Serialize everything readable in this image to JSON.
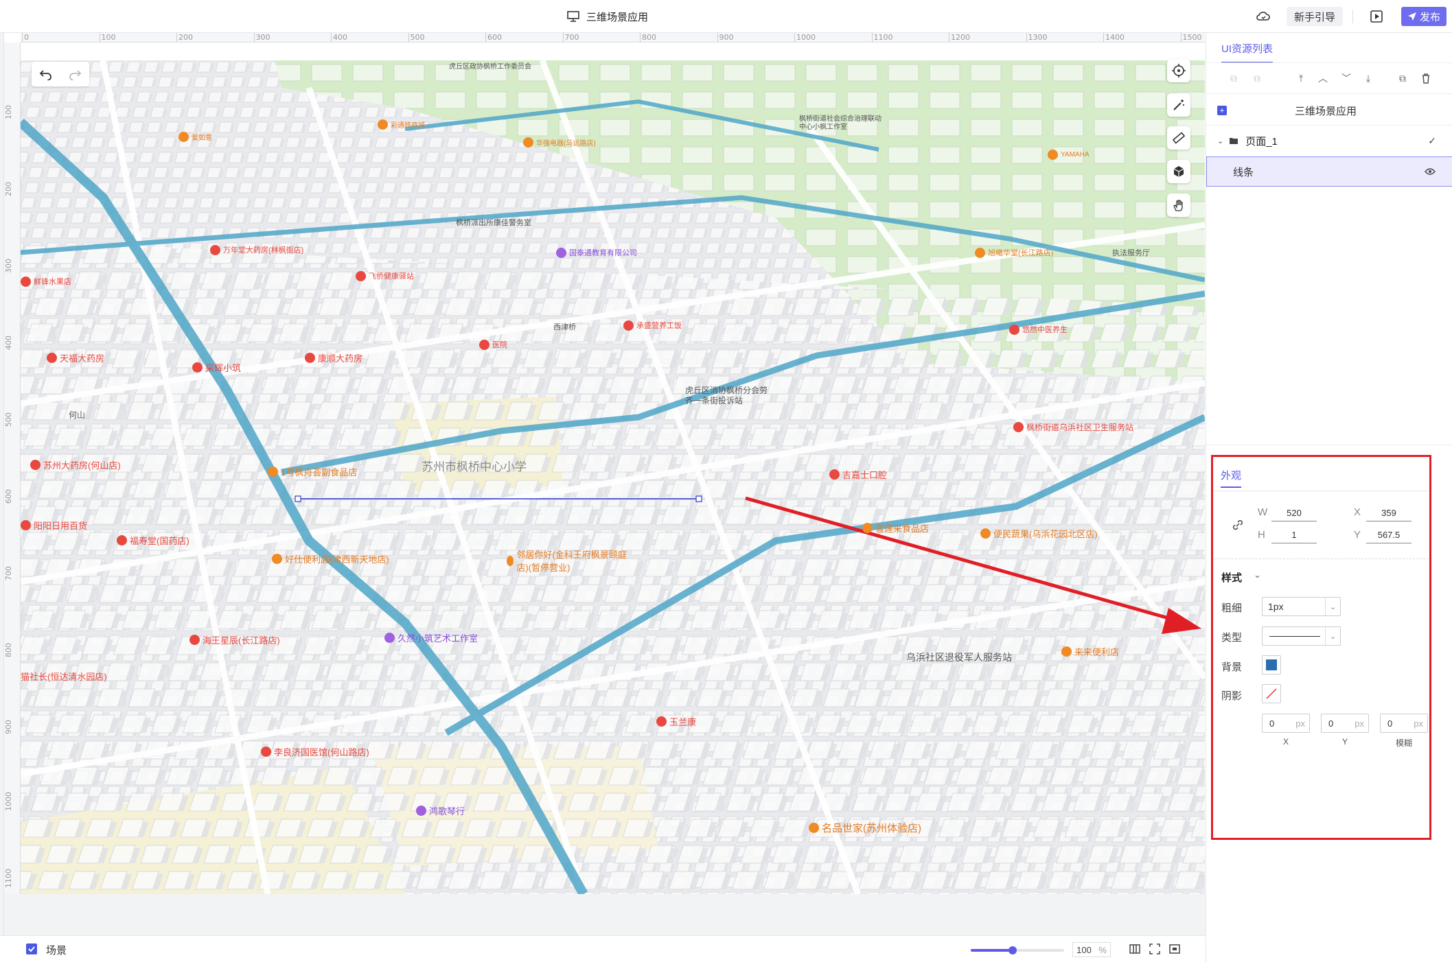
{
  "topbar": {
    "app_title": "三维场景应用",
    "guide_button": "新手引导",
    "publish_button": "发布",
    "icons": [
      "monitor-icon",
      "cloud-sync-icon",
      "play-icon",
      "send-icon"
    ]
  },
  "ruler": {
    "h_ticks": [
      "0",
      "100",
      "200",
      "300",
      "400",
      "500",
      "600",
      "700",
      "800",
      "900",
      "1000",
      "1100",
      "1200",
      "1300",
      "1400",
      "1500"
    ],
    "v_ticks": [
      "100",
      "200",
      "300",
      "400",
      "500",
      "600",
      "700",
      "800",
      "900",
      "1000",
      "1100"
    ]
  },
  "map": {
    "school_label": "苏州市枫桥中心小学",
    "labels": [
      "苏州大药房(何山店)",
      "1号枫舟荟副食品店",
      "阳阳日用百货",
      "福寿堂(国药店)",
      "好仕便利店(津西新天地店)",
      "邻居你好(金科王府枫景颐庭店)(暂停营业)",
      "海王星辰(长江路店)",
      "久然小筑艺术工作室",
      "猫社长(恒达清水园店)",
      "李良济国医馆(何山路店)",
      "鸿歌琴行",
      "玉兰康",
      "名品世家(苏州体验店)",
      "便民蔬果(乌浜花园北区店)",
      "喜莲来食品店",
      "来来便利店",
      "乌浜社区退役军人服务站",
      "吉嘉士口腔",
      "虎丘区消协枫桥分会劳齐一条街投诉站",
      "枫桥街道乌浜社区卫生服务站",
      "天福大药房",
      "采辉小筑",
      "康顺大药房",
      "万年堂大药房(林枫街店)",
      "飞侨健康驿站",
      "鲜锋水果店",
      "国泰通教育有限公司",
      "承盛营养工饭",
      "西津桥",
      "枫桥派出所康佳警务室",
      "何山",
      "医院",
      "悠然中医养生",
      "旭曦华堂(长江路店)",
      "执法服务厅",
      "YAMAHA",
      "枫桥街道社会综合治理联动中心小枫工作室",
      "虎丘区政协枫桥工作委员会",
      "华强电器(马运路店)",
      "彩通移商城",
      "爱如意"
    ],
    "line_shape": {
      "w": "520",
      "h": "1",
      "x": "359",
      "y": "567.5"
    }
  },
  "bottombar": {
    "scene_label": "场景",
    "zoom_value": "100",
    "zoom_unit": "%",
    "zoom_fraction": 0.45
  },
  "right_panel": {
    "tab_label": "UI资源列表",
    "tree": {
      "app": "三维场景应用",
      "page": "页面_1",
      "layer": "线条"
    },
    "appearance": {
      "tab": "外观",
      "w_label": "W",
      "w_value": "520",
      "h_label": "H",
      "h_value": "1",
      "x_label": "X",
      "x_value": "359",
      "y_label": "Y",
      "y_value": "567.5",
      "style_title": "样式",
      "thickness_label": "粗细",
      "thickness_value": "1px",
      "type_label": "类型",
      "background_label": "背景",
      "background_color": "#2a6eb0",
      "shadow_label": "阴影",
      "shadow_x": "0",
      "shadow_y": "0",
      "shadow_blur": "0",
      "unit": "px",
      "sub_x": "X",
      "sub_y": "Y",
      "sub_blur": "模糊"
    }
  },
  "colors": {
    "accent": "#5b5be8",
    "annotation": "#e01e26",
    "river": "#4fa6c8",
    "park": "#cfe9c0"
  }
}
